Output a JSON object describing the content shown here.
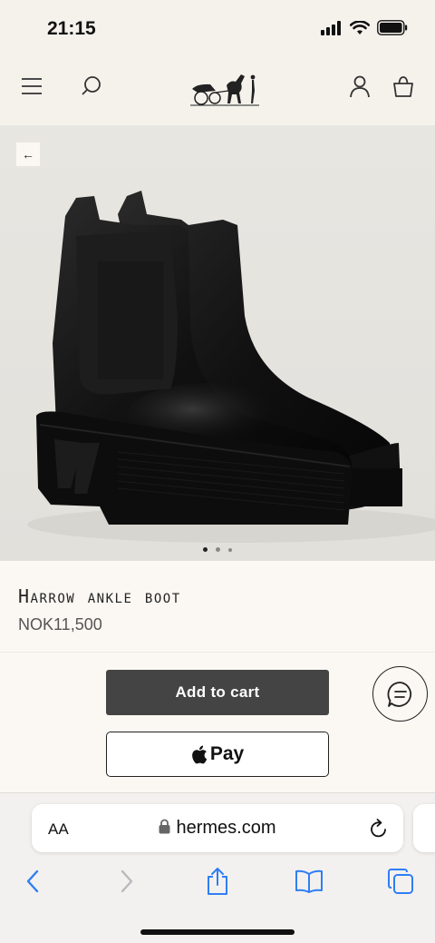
{
  "status_bar": {
    "time": "21:15"
  },
  "header": {
    "menu_icon": "hamburger-menu-icon",
    "search_icon": "search-icon",
    "logo": "carriage-logo",
    "account_icon": "account-icon",
    "bag_icon": "shopping-bag-icon"
  },
  "product": {
    "title": "Harrow ankle boot",
    "price": "NOK11,500",
    "gallery": {
      "slide_count": 3,
      "active_index": 0
    }
  },
  "actions": {
    "add_to_cart": "Add to cart",
    "apple_pay": "Pay"
  },
  "safari": {
    "text_size": "AA",
    "url": "hermes.com"
  },
  "colors": {
    "page_bg": "#fbf8f3",
    "header_bg": "#f5f2ec",
    "cta_bg": "#444444"
  }
}
